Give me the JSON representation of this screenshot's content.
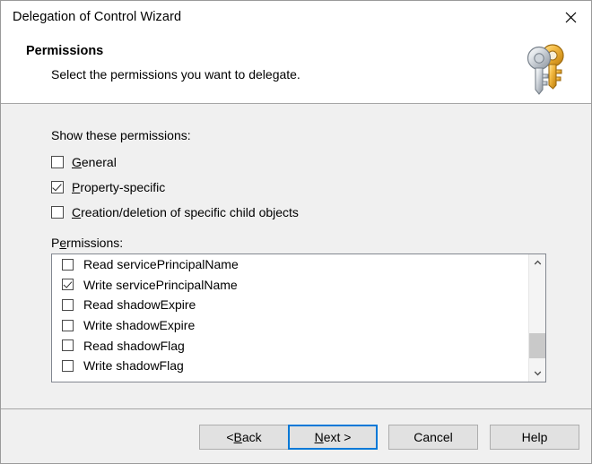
{
  "window": {
    "title": "Delegation of Control Wizard",
    "close_icon": "close-icon"
  },
  "header": {
    "title": "Permissions",
    "subtitle": "Select the permissions you want to delegate.",
    "icon": "keys-icon"
  },
  "body": {
    "show_label": "Show these permissions:",
    "permissions_label": "Permissions:",
    "scope_checkboxes": [
      {
        "label": "General",
        "accel": "G",
        "checked": false
      },
      {
        "label": "Property-specific",
        "accel": "P",
        "checked": true
      },
      {
        "label": "Creation/deletion of specific child objects",
        "accel": "C",
        "checked": false
      }
    ],
    "permissions_list": [
      {
        "label": "Read servicePrincipalName",
        "checked": false
      },
      {
        "label": "Write servicePrincipalName",
        "checked": true
      },
      {
        "label": "Read shadowExpire",
        "checked": false
      },
      {
        "label": "Write shadowExpire",
        "checked": false
      },
      {
        "label": "Read shadowFlag",
        "checked": false
      },
      {
        "label": "Write shadowFlag",
        "checked": false
      }
    ],
    "scrollbar": {
      "up_icon": "chevron-up-icon",
      "down_icon": "chevron-down-icon",
      "thumb_position_percent": 66
    }
  },
  "footer": {
    "buttons": [
      {
        "label": "< Back",
        "name": "back-button",
        "focused": false
      },
      {
        "label": "Next >",
        "name": "next-button",
        "focused": true
      },
      {
        "label": "Cancel",
        "name": "cancel-button",
        "focused": false
      },
      {
        "label": "Help",
        "name": "help-button",
        "focused": false
      }
    ]
  },
  "colors": {
    "focus_blue": "#0078d7",
    "dialog_gray": "#f0f0f0",
    "button_face": "#e1e1e1",
    "border_gray": "#a6a6a6"
  }
}
